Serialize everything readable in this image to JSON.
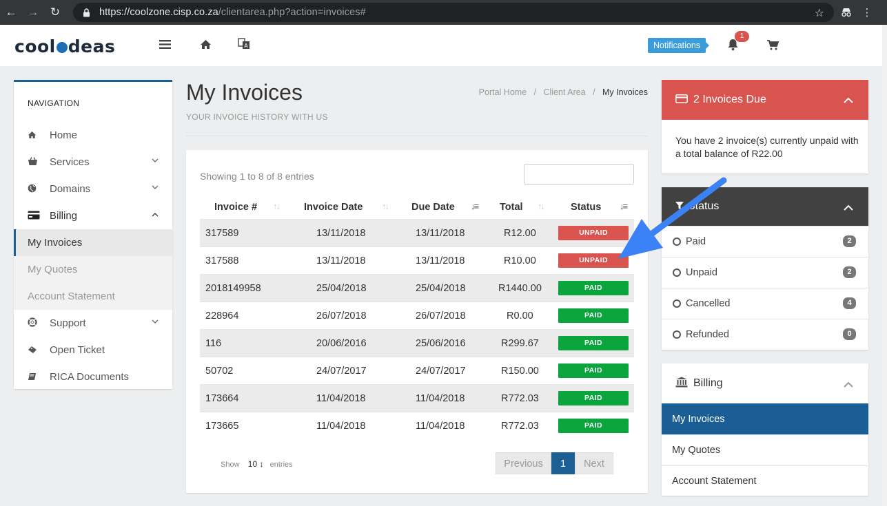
{
  "browser": {
    "url_host": "https://coolzone.cisp.co.za",
    "url_path": "/clientarea.php?action=invoices#"
  },
  "header": {
    "logo_left": "cool",
    "logo_right": "deas",
    "notifications_label": "Notifications",
    "notification_count": "1"
  },
  "sidebar": {
    "title": "NAVIGATION",
    "items": [
      {
        "label": "Home",
        "icon": "home-icon"
      },
      {
        "label": "Services",
        "icon": "basket-icon"
      },
      {
        "label": "Domains",
        "icon": "globe-icon"
      },
      {
        "label": "Billing",
        "icon": "credit-card-icon"
      },
      {
        "label": "Support",
        "icon": "life-ring-icon"
      },
      {
        "label": "Open Ticket",
        "icon": "ticket-icon"
      },
      {
        "label": "RICA Documents",
        "icon": "book-icon"
      }
    ],
    "billing_sub": [
      "My Invoices",
      "My Quotes",
      "Account Statement"
    ]
  },
  "page": {
    "title": "My Invoices",
    "subtitle": "YOUR INVOICE HISTORY WITH US",
    "breadcrumb": [
      "Portal Home",
      "Client Area",
      "My Invoices"
    ]
  },
  "table": {
    "showing": "Showing 1 to 8 of 8 entries",
    "columns": [
      "Invoice #",
      "Invoice Date",
      "Due Date",
      "Total",
      "Status"
    ],
    "rows": [
      {
        "id": "317589",
        "date": "13/11/2018",
        "due": "13/11/2018",
        "total": "R12.00",
        "status": "UNPAID"
      },
      {
        "id": "317588",
        "date": "13/11/2018",
        "due": "13/11/2018",
        "total": "R10.00",
        "status": "UNPAID"
      },
      {
        "id": "2018149958",
        "date": "25/04/2018",
        "due": "25/04/2018",
        "total": "R1440.00",
        "status": "PAID"
      },
      {
        "id": "228964",
        "date": "26/07/2018",
        "due": "26/07/2018",
        "total": "R0.00",
        "status": "PAID"
      },
      {
        "id": "116",
        "date": "20/06/2016",
        "due": "25/06/2016",
        "total": "R299.67",
        "status": "PAID"
      },
      {
        "id": "50702",
        "date": "24/07/2017",
        "due": "24/07/2017",
        "total": "R150.00",
        "status": "PAID"
      },
      {
        "id": "173664",
        "date": "11/04/2018",
        "due": "11/04/2018",
        "total": "R772.03",
        "status": "PAID"
      },
      {
        "id": "173665",
        "date": "11/04/2018",
        "due": "11/04/2018",
        "total": "R772.03",
        "status": "PAID"
      }
    ],
    "show_label": "Show",
    "page_size": "10",
    "entries_label": "entries",
    "pager": {
      "prev": "Previous",
      "current": "1",
      "next": "Next"
    }
  },
  "due_panel": {
    "title": "2 Invoices Due",
    "body": "You have 2 invoice(s) currently unpaid with a total balance of R22.00"
  },
  "status_panel": {
    "title": "Status",
    "items": [
      {
        "label": "Paid",
        "count": "2"
      },
      {
        "label": "Unpaid",
        "count": "2"
      },
      {
        "label": "Cancelled",
        "count": "4"
      },
      {
        "label": "Refunded",
        "count": "0"
      }
    ]
  },
  "billing_panel": {
    "title": "Billing",
    "items": [
      "My Invoices",
      "My Quotes",
      "Account Statement"
    ]
  },
  "colors": {
    "primary": "#1c5f93",
    "danger": "#d9534f",
    "success": "#0aa53c",
    "annotation_arrow": "#3b82f6"
  }
}
